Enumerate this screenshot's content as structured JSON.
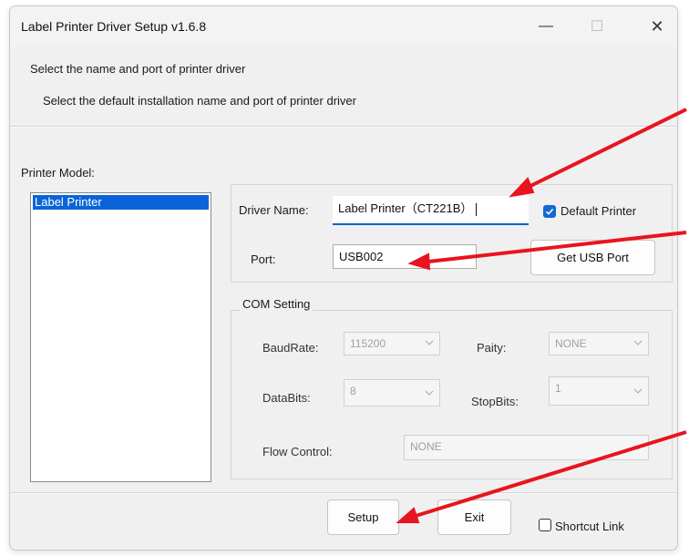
{
  "window": {
    "title": "Label Printer Driver Setup v1.6.8",
    "controls": {
      "minimize": "—",
      "maximize": "☐",
      "close": "✕"
    }
  },
  "header": {
    "line1": "Select the name and port of printer driver",
    "line2": "Select the default installation name and port of printer driver"
  },
  "printer_model": {
    "label": "Printer Model:",
    "items": [
      "Label Printer"
    ],
    "selected": "Label Printer"
  },
  "driver": {
    "name_label": "Driver Name:",
    "name_value": "Label Printer（CT221B）",
    "default_printer_label": "Default Printer",
    "default_printer_checked": true,
    "port_label": "Port:",
    "port_value": "USB002",
    "get_usb_port_label": "Get USB Port"
  },
  "com_setting": {
    "title": "COM Setting",
    "baudrate_label": "BaudRate:",
    "baudrate_value": "115200",
    "parity_label": "Paity:",
    "parity_value": "NONE",
    "databits_label": "DataBits:",
    "databits_value": "8",
    "stopbits_label": "StopBits:",
    "stopbits_value": "1",
    "flow_control_label": "Flow Control:",
    "flow_control_value": "NONE"
  },
  "footer": {
    "setup_label": "Setup",
    "exit_label": "Exit",
    "shortcut_label": "Shortcut Link",
    "shortcut_checked": false
  },
  "colors": {
    "annotation_arrow": "#e8141e",
    "selection": "#0a64d8",
    "checkbox": "#1668d2"
  }
}
